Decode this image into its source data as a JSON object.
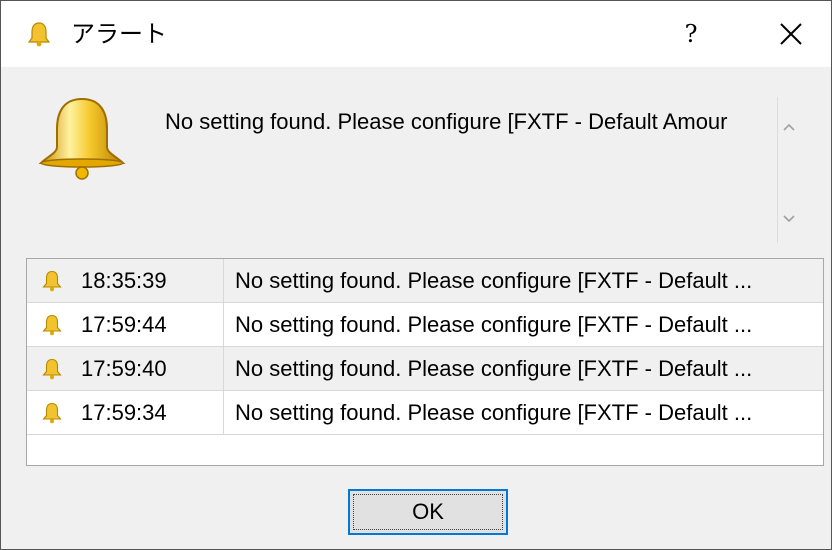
{
  "window": {
    "title": "アラート",
    "help_label": "?",
    "close_icon": "close-icon"
  },
  "message": {
    "text": "No setting found. Please configure [FXTF - Default Amour",
    "icon": "bell-icon"
  },
  "alerts": [
    {
      "time": "18:35:39",
      "text": "No setting found. Please configure [FXTF - Default ..."
    },
    {
      "time": "17:59:44",
      "text": "No setting found. Please configure [FXTF - Default ..."
    },
    {
      "time": "17:59:40",
      "text": "No setting found. Please configure [FXTF - Default ..."
    },
    {
      "time": "17:59:34",
      "text": "No setting found. Please configure [FXTF - Default ..."
    }
  ],
  "buttons": {
    "ok_label": "OK"
  },
  "colors": {
    "bell_gold": "#f2c230",
    "focus_blue": "#0078d7"
  }
}
